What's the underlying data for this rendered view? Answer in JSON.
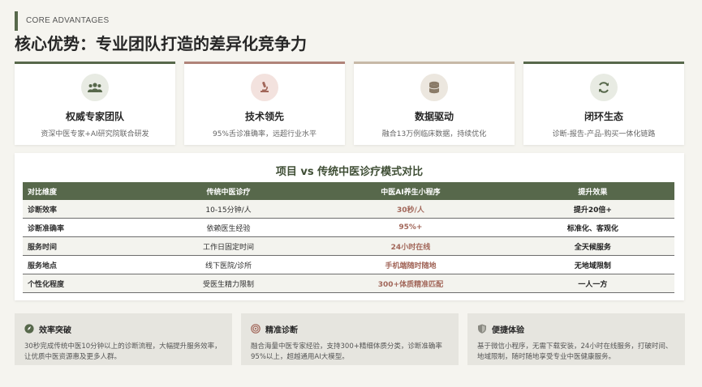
{
  "header": {
    "eyebrow": "CORE ADVANTAGES",
    "title": "核心优势：专业团队打造的差异化竞争力"
  },
  "cards": [
    {
      "icon": "users-icon",
      "title": "权威专家团队",
      "subtitle": "资深中医专家+AI研究院联合研发",
      "accent": "#57684b"
    },
    {
      "icon": "microscope-icon",
      "title": "技术领先",
      "subtitle": "95%舌诊准确率，远超行业水平",
      "accent": "#b08379"
    },
    {
      "icon": "database-icon",
      "title": "数据驱动",
      "subtitle": "融合13万例临床数据，持续优化",
      "accent": "#c7b9a7"
    },
    {
      "icon": "sync-icon",
      "title": "闭环生态",
      "subtitle": "诊断-报告-产品-购买一体化链路",
      "accent": "#57684b"
    }
  ],
  "comparison": {
    "title": "项目 vs 传统中医诊疗模式对比",
    "columns": [
      "对比维度",
      "传统中医诊疗",
      "中医AI养生小程序",
      "提升效果"
    ],
    "rows": [
      [
        "诊断效率",
        "10-15分钟/人",
        "30秒/人",
        "提升20倍+"
      ],
      [
        "诊断准确率",
        "依赖医生经验",
        "95%+",
        "标准化、客观化"
      ],
      [
        "服务时间",
        "工作日固定时间",
        "24小时在线",
        "全天候服务"
      ],
      [
        "服务地点",
        "线下医院/诊所",
        "手机端随时随地",
        "无地域限制"
      ],
      [
        "个性化程度",
        "受医生精力限制",
        "300+体质精准匹配",
        "一人一方"
      ]
    ]
  },
  "benefits": [
    {
      "icon": "rocket-icon",
      "title": "效率突破",
      "text": "30秒完成传统中医10分钟以上的诊断流程，大幅提升服务效率，让优质中医资源惠及更多人群。"
    },
    {
      "icon": "target-icon",
      "title": "精准诊断",
      "text": "融合海量中医专家经验，支持300+精细体质分类，诊断准确率95%以上，超越通用AI大模型。"
    },
    {
      "icon": "shield-icon",
      "title": "便捷体验",
      "text": "基于微信小程序，无需下载安装，24小时在线服务，打破时间、地域限制，随时随地享受专业中医健康服务。"
    }
  ],
  "colors": {
    "primary": "#57684b",
    "highlight": "#a2675a",
    "background": "#f5f4ef"
  }
}
